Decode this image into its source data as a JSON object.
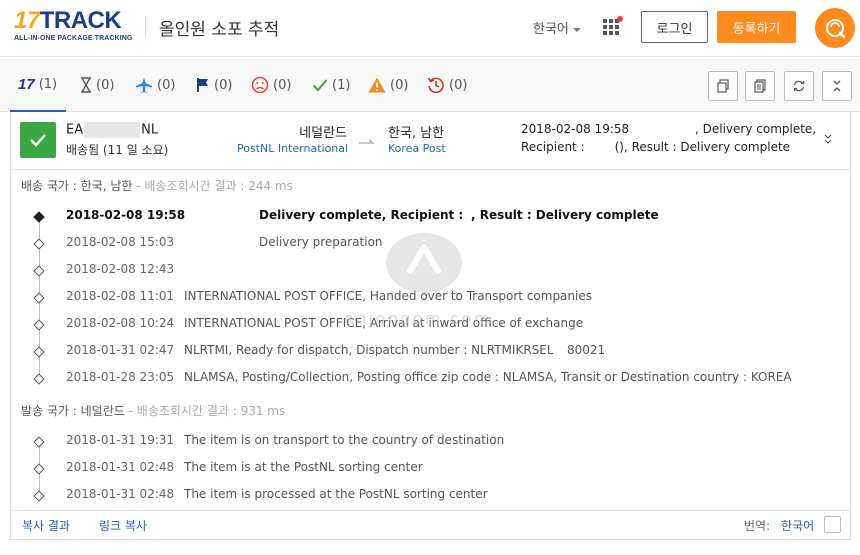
{
  "header": {
    "logo_main_17": "17",
    "logo_main_track": "TRACK",
    "logo_sub": "ALL-IN-ONE PACKAGE TRACKING",
    "title": "올인원 소포 추적",
    "language": "한국어",
    "login_label": "로그인",
    "register_label": "등록하기",
    "accent_color": "#ff8a1d"
  },
  "toolbar": {
    "tabs": [
      {
        "icon": "17track-logo-icon",
        "count": "(1)"
      },
      {
        "icon": "hourglass-icon",
        "count": "(0)"
      },
      {
        "icon": "airplane-icon",
        "count": "(0)"
      },
      {
        "icon": "flag-icon",
        "count": "(0)"
      },
      {
        "icon": "sad-face-icon",
        "count": "(0)"
      },
      {
        "icon": "checkmark-icon",
        "count": "(1)"
      },
      {
        "icon": "warning-icon",
        "count": "(0)"
      },
      {
        "icon": "history-icon",
        "count": "(0)"
      }
    ],
    "actions": [
      "copy-icon",
      "copy-all-icon",
      "refresh-icon",
      "collapse-icon"
    ]
  },
  "summary": {
    "tracking_prefix": "EA",
    "tracking_suffix": "NL",
    "status": "배송됨 (11 일 소요)",
    "origin_country": "네덜란드",
    "origin_carrier": "PostNL International ...",
    "dest_country": "한국, 남한",
    "dest_carrier": "Korea Post",
    "latest_time": "2018-02-08 19:58",
    "latest_desc_line1": ", Delivery complete,",
    "latest_desc_line2_a": "Recipient :",
    "latest_desc_line2_b": "(), Result : Delivery complete"
  },
  "destination_section": {
    "label": "배송 국가 : 한국, 남한",
    "timing": " - 배송조회시간 결과 : 244 ms",
    "events": [
      {
        "time": "2018-02-08 19:58",
        "desc": "Delivery complete, Recipient :",
        "desc2": ", Result : Delivery complete"
      },
      {
        "time": "2018-02-08 15:03",
        "desc": "Delivery preparation"
      },
      {
        "time": "2018-02-08 12:43",
        "desc": ""
      },
      {
        "time": "2018-02-08 11:01",
        "desc": "INTERNATIONAL POST OFFICE, Handed over to Transport companies"
      },
      {
        "time": "2018-02-08 10:24",
        "desc": "INTERNATIONAL POST OFFICE, Arrival at inward office of exchange"
      },
      {
        "time": "2018-01-31 02:47",
        "desc": "NLRTMI, Ready for dispatch, Dispatch number : NLRTMIKRSEL",
        "desc2": "80021"
      },
      {
        "time": "2018-01-28 23:05",
        "desc": "NLAMSA, Posting/Collection, Posting office zip code : NLAMSA, Transit or Destination country : KOREA"
      }
    ]
  },
  "origin_section": {
    "label": "발송 국가 : 네덜란드",
    "timing": " - 배송조회시간 결과 : 931 ms",
    "events": [
      {
        "time": "2018-01-31 19:31",
        "desc": "The item is on transport to the country of destination"
      },
      {
        "time": "2018-01-31 02:48",
        "desc": "The item is at the PostNL sorting center"
      },
      {
        "time": "2018-01-31 02:48",
        "desc": "The item is processed at the PostNL sorting center"
      }
    ]
  },
  "footer": {
    "copy_result": "복사 결과",
    "copy_link": "링크 복사",
    "translate_label": "번역:",
    "translate_value": "한국어"
  },
  "watermark": "anjongom.com"
}
